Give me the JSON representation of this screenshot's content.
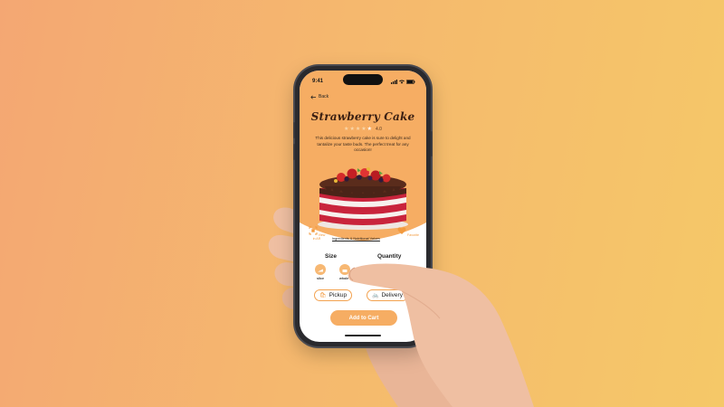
{
  "status": {
    "time": "9:41"
  },
  "nav": {
    "back_label": "Back"
  },
  "product": {
    "title": "Strawberry Cake",
    "rating": "4.0",
    "description": "This delicious strawberry cake is sure to delight and tantalize your taste buds. The perfect treat for any occasion!"
  },
  "actions": {
    "view_ar": "View in AR",
    "ingredients": "Ingredients & Nutritional Values",
    "favorite": "Favorite"
  },
  "size": {
    "label": "Size",
    "options": [
      "slice",
      "whole"
    ]
  },
  "quantity": {
    "label": "Quantity"
  },
  "fulfillment": {
    "pickup": "Pickup",
    "delivery": "Delivery"
  },
  "cart": {
    "label": "Add to Cart"
  },
  "colors": {
    "accent": "#f6ad63",
    "background_left": "#f4a773",
    "background_right": "#f5c868",
    "title": "#3a1f12"
  },
  "icons": [
    "back-arrow-icon",
    "signal-icon",
    "wifi-icon",
    "battery-icon",
    "star-icon",
    "ar-icon",
    "heart-icon",
    "bag-icon",
    "bicycle-icon"
  ]
}
